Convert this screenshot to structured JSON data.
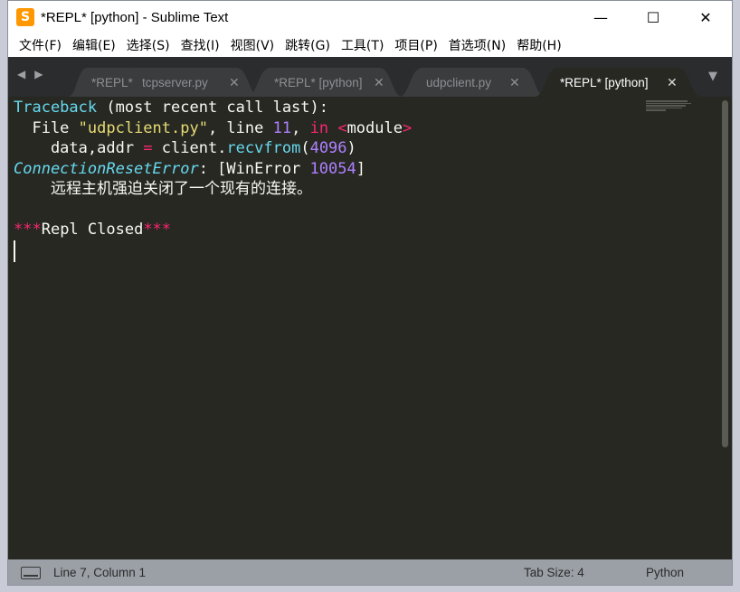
{
  "window": {
    "title": "*REPL* [python] - Sublime Text",
    "app_icon_glyph": "S",
    "controls": {
      "minimize": "—",
      "maximize": "☐",
      "close": "✕"
    }
  },
  "menu": [
    "文件(F)",
    "编辑(E)",
    "选择(S)",
    "查找(I)",
    "视图(V)",
    "跳转(G)",
    "工具(T)",
    "项目(P)",
    "首选项(N)",
    "帮助(H)"
  ],
  "tabs": {
    "nav_prev": "◀",
    "nav_next": "▶",
    "items": [
      {
        "label": "*REPL*",
        "close": ""
      },
      {
        "label": "tcpserver.py",
        "close": "✕"
      },
      {
        "label": "*REPL* [python]",
        "close": "✕"
      },
      {
        "label": "udpclient.py",
        "close": "✕"
      },
      {
        "label": "*REPL* [python]",
        "close": "✕",
        "active": true
      }
    ],
    "dropdown": "▼"
  },
  "editor": {
    "lines": [
      [
        {
          "t": "Traceback",
          "c": "#66d9ef"
        },
        {
          "t": " (most recent call last):",
          "c": "#f8f8f2"
        }
      ],
      [
        {
          "t": "  File ",
          "c": "#f8f8f2"
        },
        {
          "t": "\"udpclient.py\"",
          "c": "#e6db74"
        },
        {
          "t": ", line ",
          "c": "#f8f8f2"
        },
        {
          "t": "11",
          "c": "#ae81ff"
        },
        {
          "t": ", ",
          "c": "#f8f8f2"
        },
        {
          "t": "in",
          "c": "#f92672"
        },
        {
          "t": " ",
          "c": "#f8f8f2"
        },
        {
          "t": "<",
          "c": "#f92672"
        },
        {
          "t": "module",
          "c": "#f8f8f2"
        },
        {
          "t": ">",
          "c": "#f92672"
        }
      ],
      [
        {
          "t": "    data,addr ",
          "c": "#f8f8f2"
        },
        {
          "t": "=",
          "c": "#f92672"
        },
        {
          "t": " client.",
          "c": "#f8f8f2"
        },
        {
          "t": "recvfrom",
          "c": "#66d9ef"
        },
        {
          "t": "(",
          "c": "#f8f8f2"
        },
        {
          "t": "4096",
          "c": "#ae81ff"
        },
        {
          "t": ")",
          "c": "#f8f8f2"
        }
      ],
      [
        {
          "t": "ConnectionResetError",
          "c": "#66d9ef",
          "italic": true
        },
        {
          "t": ": [WinError ",
          "c": "#f8f8f2"
        },
        {
          "t": "10054",
          "c": "#ae81ff"
        },
        {
          "t": "]",
          "c": "#f8f8f2"
        }
      ],
      [
        {
          "t": "    远程主机强迫关闭了一个现有的连接。",
          "c": "#f8f8f2"
        }
      ],
      [],
      [
        {
          "t": "***",
          "c": "#f92672"
        },
        {
          "t": "Repl Closed",
          "c": "#f8f8f2"
        },
        {
          "t": "***",
          "c": "#f92672"
        }
      ]
    ]
  },
  "status": {
    "position": "Line 7, Column 1",
    "tab_size": "Tab Size: 4",
    "syntax": "Python"
  },
  "colors": {
    "editor_bg": "#272822",
    "tabbar_bg": "#2a2c2e",
    "statusbar_bg": "#9aa0a6"
  }
}
